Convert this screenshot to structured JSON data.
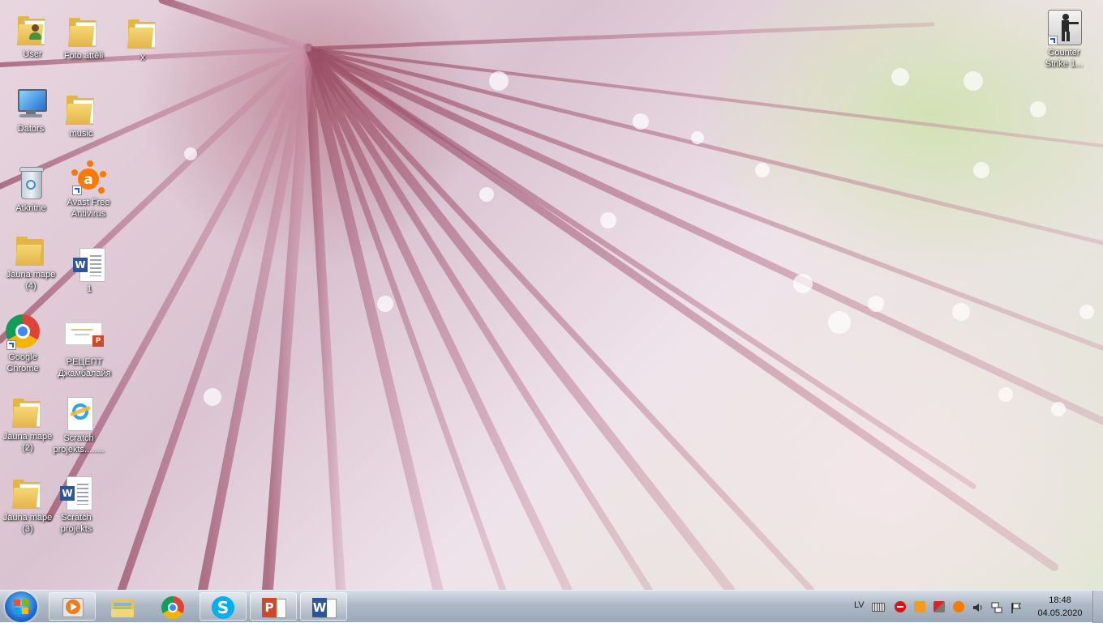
{
  "desktop": {
    "icons": [
      {
        "label": "User",
        "icon": "user-folder-icon"
      },
      {
        "label": "Foto attēli",
        "icon": "folder-icon"
      },
      {
        "label": "x",
        "icon": "folder-icon"
      },
      {
        "label": "Dators",
        "icon": "computer-icon"
      },
      {
        "label": "music",
        "icon": "folder-icon"
      },
      {
        "label": "Atkritne",
        "icon": "recycle-bin-icon"
      },
      {
        "label": "Avast Free\nAntivirus",
        "icon": "avast-icon"
      },
      {
        "label": "Jauna mape\n(4)",
        "icon": "folder-icon"
      },
      {
        "label": "1",
        "icon": "word-document-icon"
      },
      {
        "label": "Google\nChrome",
        "icon": "chrome-icon"
      },
      {
        "label": "РЕЦЕПТ\nДжамбалайя",
        "icon": "powerpoint-document-icon"
      },
      {
        "label": "Jauna mape\n(2)",
        "icon": "folder-icon"
      },
      {
        "label": "Scratch\nprojekts........",
        "icon": "internet-explorer-document-icon"
      },
      {
        "label": "Jauna mape\n(3)",
        "icon": "folder-icon"
      },
      {
        "label": "Scratch\nprojekts",
        "icon": "word-document-icon"
      },
      {
        "label": "Counter\nStrike 1...",
        "icon": "counter-strike-icon"
      }
    ]
  },
  "taskbar": {
    "pinned": [
      {
        "name": "media-player",
        "icon": "media-player-icon"
      },
      {
        "name": "explorer",
        "icon": "explorer-icon"
      },
      {
        "name": "chrome",
        "icon": "chrome-icon"
      },
      {
        "name": "skype",
        "icon": "skype-icon"
      },
      {
        "name": "powerpoint",
        "icon": "powerpoint-icon"
      },
      {
        "name": "word",
        "icon": "word-icon"
      }
    ],
    "tray": {
      "language": "LV",
      "time": "18:48",
      "date": "04.05.2020"
    }
  },
  "colors": {
    "word": "#2b579a",
    "powerpoint": "#d24726",
    "skype": "#00aff0",
    "avast": "#ff7800",
    "folder": "#e2b544"
  }
}
